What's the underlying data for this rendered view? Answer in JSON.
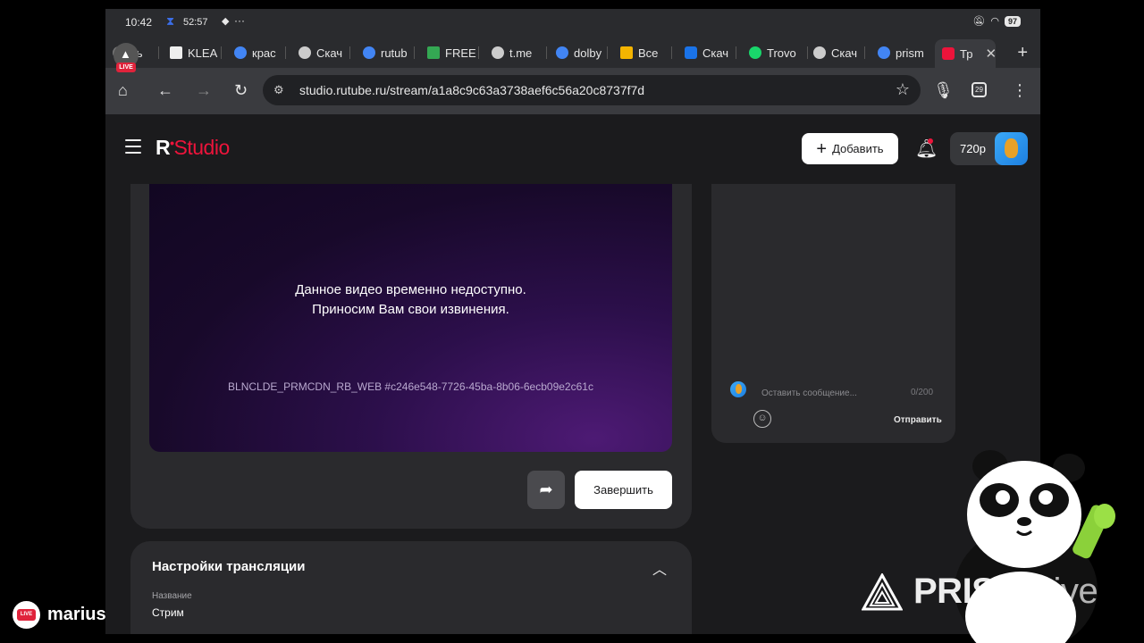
{
  "status_bar": {
    "time": "10:42",
    "timer": "52:57",
    "battery": "97"
  },
  "tabs": [
    {
      "label": "чь",
      "color": "#777"
    },
    {
      "label": "KLEA",
      "color": "#eee"
    },
    {
      "label": "крас",
      "color": "#4285f4"
    },
    {
      "label": "Скач",
      "color": "#ccc"
    },
    {
      "label": "rutub",
      "color": "#4285f4"
    },
    {
      "label": "FREE",
      "color": "#34a853"
    },
    {
      "label": "t.me",
      "color": "#ccc"
    },
    {
      "label": "dolby",
      "color": "#4285f4"
    },
    {
      "label": "Все",
      "color": "#f4b400"
    },
    {
      "label": "Скач",
      "color": "#1a73e8"
    },
    {
      "label": "Trovo",
      "color": "#19d66b"
    },
    {
      "label": "Скач",
      "color": "#ccc"
    },
    {
      "label": "prism",
      "color": "#4285f4"
    },
    {
      "label": "Тр",
      "color": "#ed143b"
    }
  ],
  "toolbar": {
    "url": "studio.rutube.ru/stream/a1a8c9c63a3738aef6c56a20c8737f7d",
    "tab_count": "29"
  },
  "app": {
    "logo_r": "R",
    "logo_studio": "Studio",
    "add_button": "Добавить",
    "quality": "720p"
  },
  "player": {
    "message_line1": "Данное видео временно недоступно.",
    "message_line2": "Приносим Вам свои извинения.",
    "error_code": "BLNCLDE_PRMCDN_RB_WEB #c246e548-7726-45ba-8b06-6ecb09e2c61c",
    "end_button": "Завершить"
  },
  "chat": {
    "placeholder": "Оставить сообщение...",
    "counter": "0/200",
    "send_button": "Отправить"
  },
  "settings": {
    "title": "Настройки трансляции",
    "name_label": "Название",
    "name_value": "Стрим"
  },
  "overlay": {
    "live_badge": "LIVE",
    "username": "marius",
    "brand": "PRISM",
    "brand_live": "Live"
  }
}
